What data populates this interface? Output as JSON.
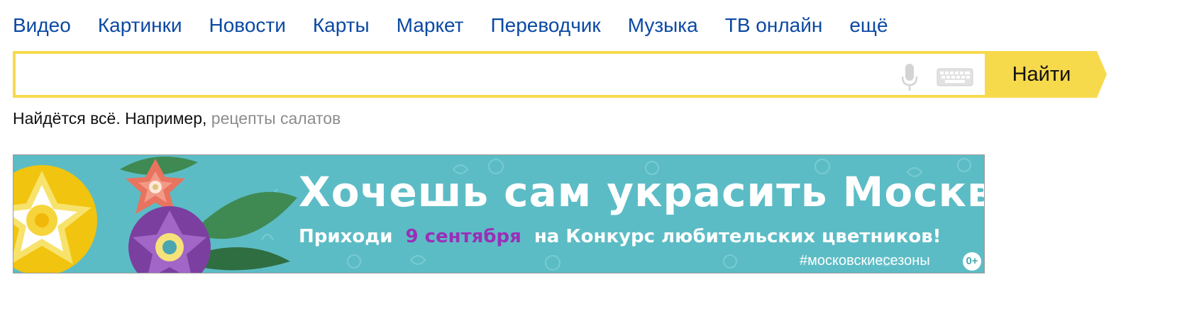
{
  "nav": {
    "items": [
      {
        "label": "Видео"
      },
      {
        "label": "Картинки"
      },
      {
        "label": "Новости"
      },
      {
        "label": "Карты"
      },
      {
        "label": "Маркет"
      },
      {
        "label": "Переводчик"
      },
      {
        "label": "Музыка"
      },
      {
        "label": "ТВ онлайн"
      },
      {
        "label": "ещё"
      }
    ]
  },
  "search": {
    "value": "",
    "button_label": "Найти",
    "accent_color": "#f7d94c"
  },
  "hint": {
    "prefix": "Найдётся всё. Например, ",
    "example": "рецепты салатов"
  },
  "banner": {
    "title": "Хочешь сам украсить Москву?",
    "sub_before": "Приходи",
    "sub_date": "9 сентября",
    "sub_after": "на Конкурс любительских цветников!",
    "hashtag": "#московскиесезоны",
    "age_rating": "0+",
    "background_color": "#5cbcc5",
    "date_color": "#9a2fb8"
  },
  "icons": {
    "mic": "microphone-icon",
    "keyboard": "keyboard-icon"
  }
}
